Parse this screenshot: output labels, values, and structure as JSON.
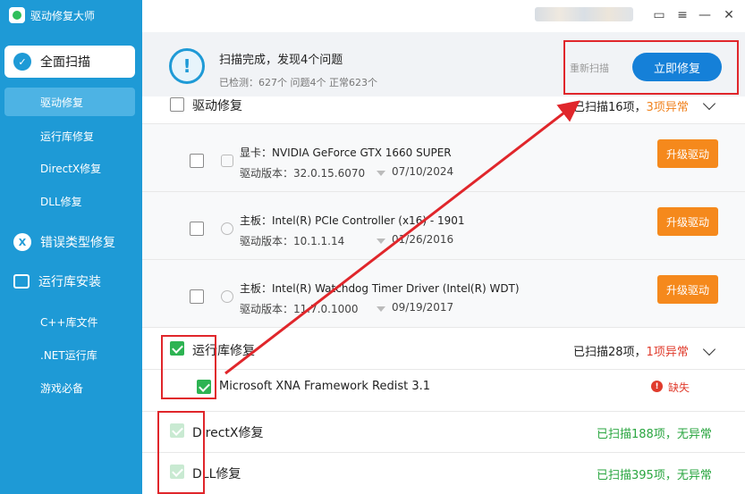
{
  "app": {
    "title": "驱动修复大师"
  },
  "sidebar": {
    "main_items": [
      {
        "label": "全面扫描",
        "icon": "scan-icon"
      },
      {
        "label": "错误类型修复",
        "icon": "x-repair-icon"
      },
      {
        "label": "运行库安装",
        "icon": "install-icon"
      }
    ],
    "sub_items": [
      "驱动修复",
      "运行库修复",
      "DirectX修复",
      "DLL修复"
    ],
    "install_items": [
      "C++库文件",
      ".NET运行库",
      "游戏必备"
    ]
  },
  "status": {
    "title": "扫描完成，发现4个问题",
    "subtitle": "已检测：627个 问题4个 正常623个",
    "rescan_label": "重新扫描",
    "fix_label": "立即修复"
  },
  "driver_section": {
    "title": "驱动修复",
    "count_prefix": "已扫描16项，",
    "count_warn": "3项异常",
    "items": [
      {
        "name": "显卡：NVIDIA GeForce GTX 1660 SUPER",
        "version": "驱动版本：32.0.15.6070",
        "date": "07/10/2024",
        "action": "升级驱动"
      },
      {
        "name": "主板：Intel(R) PCIe Controller (x16) - 1901",
        "version": "驱动版本：10.1.1.14",
        "date": "01/26/2016",
        "action": "升级驱动"
      },
      {
        "name": "主板：Intel(R) Watchdog Timer Driver (Intel(R) WDT)",
        "version": "驱动版本：11.7.0.1000",
        "date": "09/19/2017",
        "action": "升级驱动"
      }
    ]
  },
  "runtime_section": {
    "title": "运行库修复",
    "count_prefix": "已扫描28项，",
    "count_err": "1项异常",
    "items": [
      {
        "name": "Microsoft XNA Framework Redist 3.1",
        "status": "缺失"
      }
    ]
  },
  "directx_section": {
    "title": "DirectX修复",
    "count": "已扫描188项，无异常"
  },
  "dll_section": {
    "title": "DLL修复",
    "count": "已扫描395项，无异常"
  },
  "colors": {
    "sidebar": "#1e9ad6",
    "primary_button": "#1580d8",
    "upgrade_button": "#f5891c",
    "check_green": "#2db352",
    "error_red": "#e03b2c",
    "annotation_red": "#e0262b"
  }
}
